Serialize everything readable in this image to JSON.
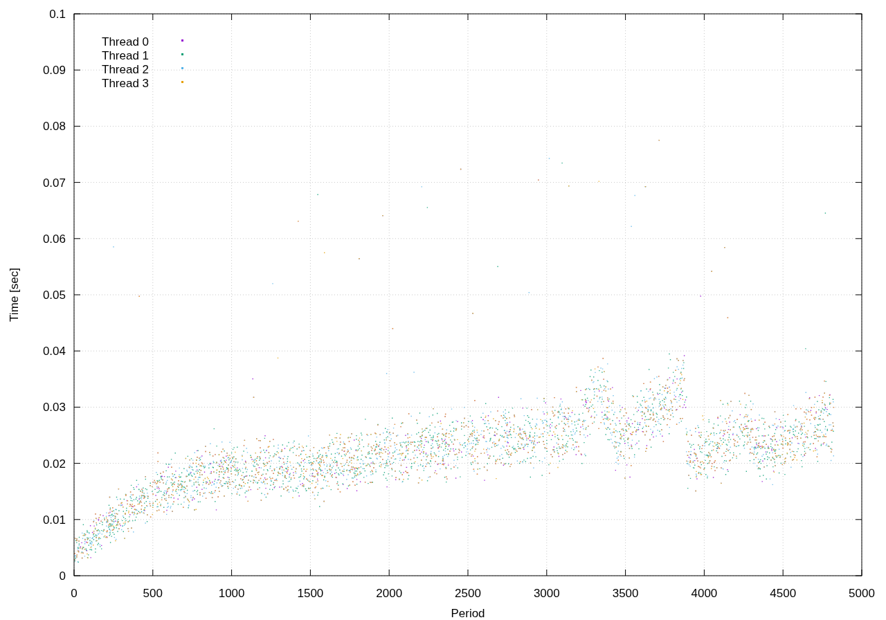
{
  "plot": {
    "xlabel": "Period",
    "ylabel": "Time [sec]",
    "x_tick_labels": [
      "0",
      "500",
      "1000",
      "1500",
      "2000",
      "2500",
      "3000",
      "3500",
      "4000",
      "4500",
      "5000"
    ],
    "y_tick_labels": [
      "0.1",
      "0.09",
      "0.08",
      "0.07",
      "0.06",
      "0.05",
      "0.04",
      "0.03",
      "0.02",
      "0.01",
      "0"
    ],
    "legend": [
      {
        "name": "Thread 0",
        "color": "#9400d3"
      },
      {
        "name": "Thread 1",
        "color": "#009e73"
      },
      {
        "name": "Thread 2",
        "color": "#56b4e9"
      },
      {
        "name": "Thread 3",
        "color": "#e69f00"
      }
    ]
  }
}
